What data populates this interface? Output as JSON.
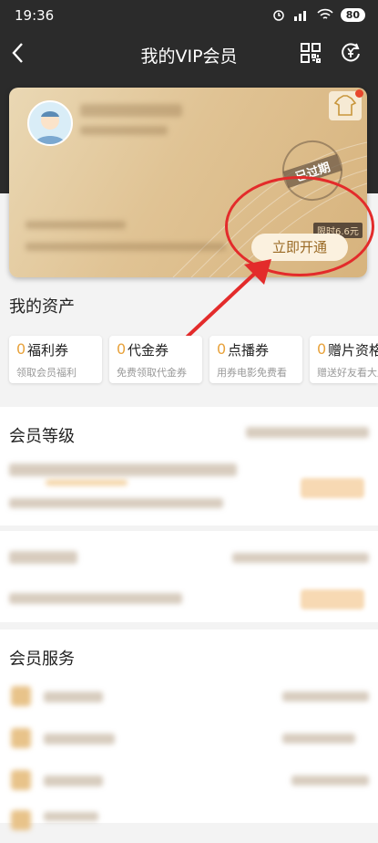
{
  "status_bar": {
    "time": "19:36",
    "battery": "80"
  },
  "nav": {
    "title": "我的VIP会员"
  },
  "vip_card": {
    "expired_stamp": "已过期",
    "promo_badge": "限时6.6元",
    "open_button": "立即开通"
  },
  "assets": {
    "title": "我的资产",
    "items": [
      {
        "count": "0",
        "name": "福利券",
        "desc": "领取会员福利"
      },
      {
        "count": "0",
        "name": "代金券",
        "desc": "免费领取代金券"
      },
      {
        "count": "0",
        "name": "点播券",
        "desc": "用券电影免费看"
      },
      {
        "count": "0",
        "name": "赠片资格",
        "desc": "赠送好友看大片"
      }
    ]
  },
  "member_level": {
    "title": "会员等级"
  },
  "member_services": {
    "title": "会员服务"
  },
  "colors": {
    "header_bg": "#2b2b2b",
    "card_gold": "#e0c394",
    "accent": "#e8a23b",
    "annotation_red": "#e32b2b"
  }
}
